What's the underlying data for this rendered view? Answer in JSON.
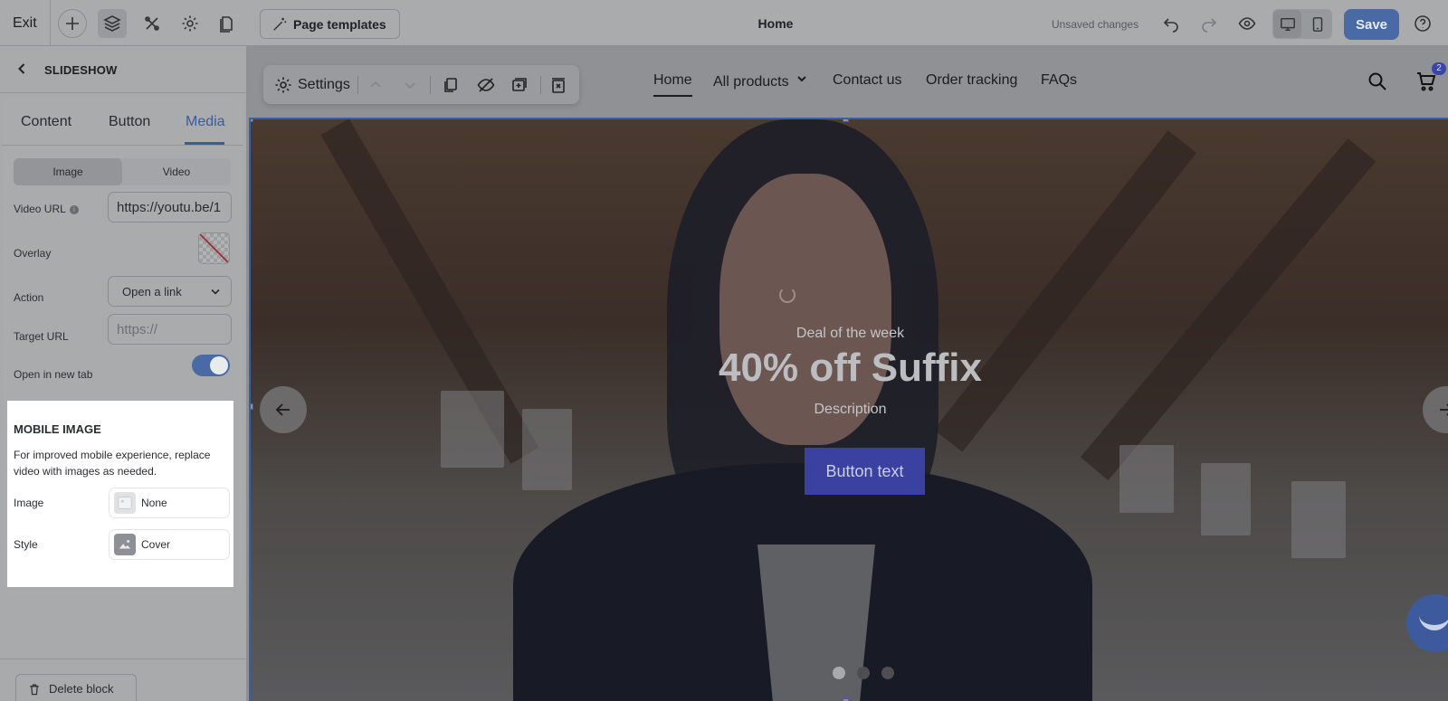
{
  "topbar": {
    "exit_label": "Exit",
    "page_templates_label": "Page templates",
    "page_title": "Home",
    "unsaved_label": "Unsaved changes",
    "save_label": "Save"
  },
  "panel": {
    "title": "SLIDESHOW",
    "tabs": [
      {
        "label": "Content"
      },
      {
        "label": "Button"
      },
      {
        "label": "Media"
      }
    ],
    "media_type": {
      "image_label": "Image",
      "video_label": "Video"
    },
    "video_url": {
      "label": "Video URL",
      "value": "https://youtu.be/1"
    },
    "overlay": {
      "label": "Overlay"
    },
    "action": {
      "label": "Action",
      "value": "Open a link"
    },
    "target_url": {
      "label": "Target URL",
      "placeholder": "https://"
    },
    "open_new_tab": {
      "label": "Open in new tab",
      "enabled": true
    },
    "mobile_image": {
      "title": "MOBILE IMAGE",
      "description": "For improved mobile experience, replace video with images as needed.",
      "image_label": "Image",
      "image_value": "None",
      "style_label": "Style",
      "style_value": "Cover"
    },
    "delete_label": "Delete block"
  },
  "storefront": {
    "settings_label": "Settings",
    "nav": [
      {
        "label": "Home"
      },
      {
        "label": "All products"
      },
      {
        "label": "Contact us"
      },
      {
        "label": "Order tracking"
      },
      {
        "label": "FAQs"
      }
    ],
    "cart_count": "2",
    "hero": {
      "eyebrow": "Deal of the week",
      "title": "40% off Suffix",
      "description": "Description",
      "button_label": "Button text",
      "slide_count": 3,
      "active_slide": 1
    }
  },
  "colors": {
    "accent": "#4a6aa6",
    "hero_button": "#3a41a0",
    "selection": "#3d5fa0"
  }
}
